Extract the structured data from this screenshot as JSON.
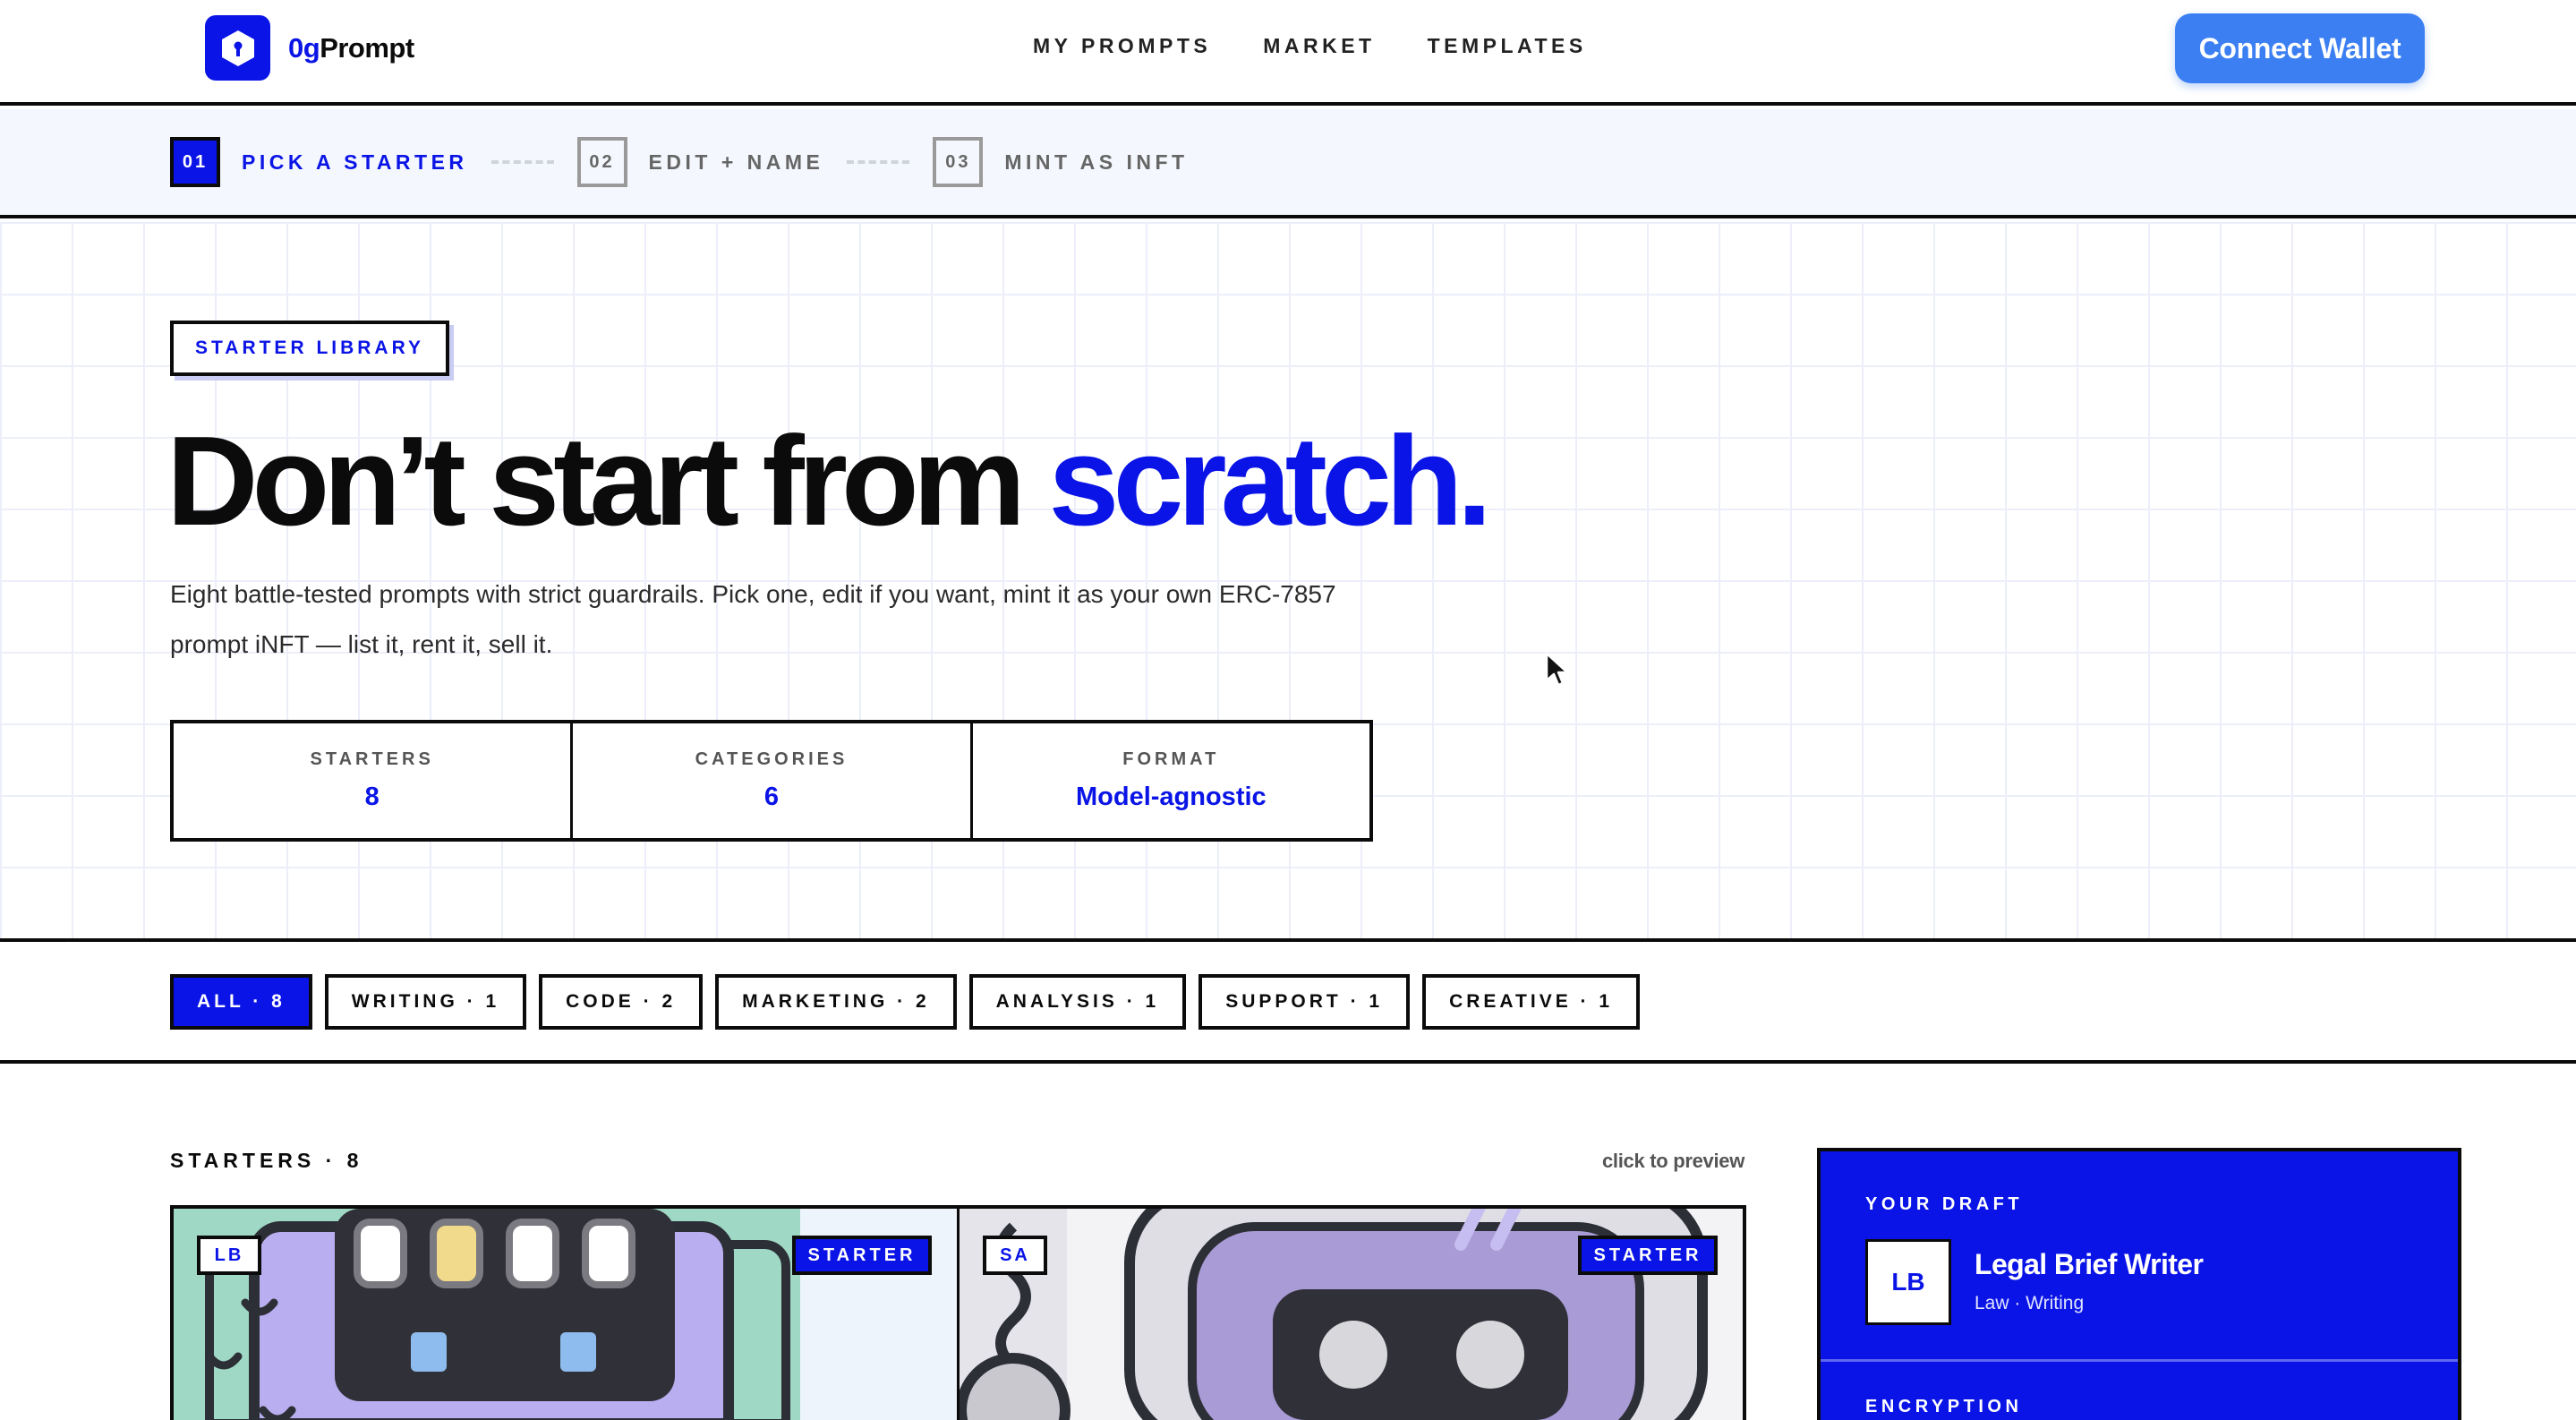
{
  "brand": {
    "name_prefix": "0g",
    "name_suffix": "Prompt"
  },
  "nav": {
    "items": [
      "MY PROMPTS",
      "MARKET",
      "TEMPLATES"
    ]
  },
  "connect_wallet": "Connect Wallet",
  "stepper": {
    "steps": [
      {
        "num": "01",
        "label": "PICK A STARTER",
        "active": true
      },
      {
        "num": "02",
        "label": "EDIT + NAME",
        "active": false
      },
      {
        "num": "03",
        "label": "MINT AS INFT",
        "active": false
      }
    ]
  },
  "hero": {
    "tag": "STARTER LIBRARY",
    "headline_main": "Don’t start from ",
    "headline_accent": "scratch.",
    "lede": "Eight battle-tested prompts with strict guardrails. Pick one, edit if you want, mint it as your own ERC-7857 prompt iNFT — list it, rent it, sell it.",
    "stats": [
      {
        "label": "STARTERS",
        "value": "8"
      },
      {
        "label": "CATEGORIES",
        "value": "6"
      },
      {
        "label": "FORMAT",
        "value": "Model-agnostic"
      }
    ]
  },
  "filters": {
    "chips": [
      "ALL · 8",
      "WRITING · 1",
      "CODE · 2",
      "MARKETING · 2",
      "ANALYSIS · 1",
      "SUPPORT · 1",
      "CREATIVE · 1"
    ],
    "active": "ALL · 8"
  },
  "starters": {
    "heading": "STARTERS · 8",
    "hint": "click to preview",
    "cards": [
      {
        "initials": "LB",
        "badge": "STARTER"
      },
      {
        "initials": "SA",
        "badge": "STARTER"
      }
    ]
  },
  "draft": {
    "label": "YOUR DRAFT",
    "avatar": "LB",
    "title": "Legal Brief Writer",
    "subtitle": "Law · Writing",
    "encryption_label": "ENCRYPTION"
  },
  "colors": {
    "accent": "#0a14e6",
    "button": "#3b7ff2",
    "ink": "#0b0b0b",
    "stepper_bg": "#f4f7fd",
    "grid_line": "#eceef9"
  },
  "icons": {
    "logo": "lock-hexagon-icon",
    "cursor": "mouse-pointer-icon"
  }
}
